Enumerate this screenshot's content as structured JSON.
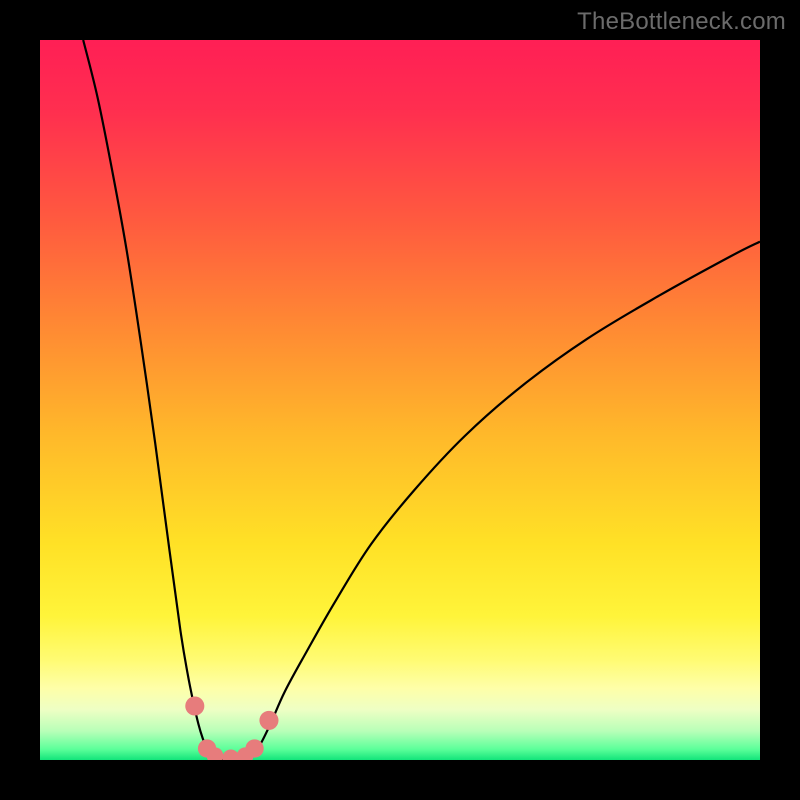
{
  "watermark": {
    "text": "TheBottleneck.com"
  },
  "colors": {
    "black": "#000000",
    "curve": "#000000",
    "marker": "#e77c7c",
    "gradient_stops": [
      {
        "offset": 0.0,
        "color": "#ff1f55"
      },
      {
        "offset": 0.1,
        "color": "#ff2f4f"
      },
      {
        "offset": 0.25,
        "color": "#ff5a3f"
      },
      {
        "offset": 0.4,
        "color": "#ff8a33"
      },
      {
        "offset": 0.55,
        "color": "#ffb92a"
      },
      {
        "offset": 0.7,
        "color": "#ffe126"
      },
      {
        "offset": 0.8,
        "color": "#fff43a"
      },
      {
        "offset": 0.86,
        "color": "#fffb72"
      },
      {
        "offset": 0.9,
        "color": "#feffa8"
      },
      {
        "offset": 0.93,
        "color": "#eeffc4"
      },
      {
        "offset": 0.96,
        "color": "#b8ffb8"
      },
      {
        "offset": 0.985,
        "color": "#5cff9a"
      },
      {
        "offset": 1.0,
        "color": "#12e47a"
      }
    ]
  },
  "chart_data": {
    "type": "line",
    "title": "",
    "xlabel": "",
    "ylabel": "",
    "xlim": [
      0,
      100
    ],
    "ylim": [
      0,
      100
    ],
    "grid": false,
    "series": [
      {
        "name": "left-curve",
        "x": [
          6,
          8,
          10,
          12,
          14,
          16,
          18,
          19.5,
          20.5,
          21.3,
          22,
          22.6,
          23.2,
          23.8
        ],
        "y": [
          100,
          92,
          82,
          71,
          58,
          44,
          29,
          18,
          12,
          8,
          5,
          3,
          1.5,
          0.4
        ]
      },
      {
        "name": "valley-floor",
        "x": [
          23.8,
          25.0,
          26.5,
          28.0,
          29.2
        ],
        "y": [
          0.4,
          0.1,
          0.05,
          0.1,
          0.4
        ]
      },
      {
        "name": "right-curve",
        "x": [
          29.2,
          30.5,
          32,
          34,
          37,
          41,
          46,
          52,
          59,
          67,
          76,
          86,
          96,
          100
        ],
        "y": [
          0.4,
          2,
          5,
          9.5,
          15,
          22,
          30,
          37.5,
          45,
          52,
          58.5,
          64.5,
          70,
          72
        ]
      }
    ],
    "markers": {
      "name": "valley-markers",
      "points": [
        {
          "x": 21.5,
          "y": 7.5,
          "r": 1.4
        },
        {
          "x": 23.2,
          "y": 1.6,
          "r": 1.3
        },
        {
          "x": 24.3,
          "y": 0.6,
          "r": 1.1
        },
        {
          "x": 26.5,
          "y": 0.3,
          "r": 1.1
        },
        {
          "x": 28.5,
          "y": 0.6,
          "r": 1.1
        },
        {
          "x": 29.8,
          "y": 1.6,
          "r": 1.3
        },
        {
          "x": 31.8,
          "y": 5.5,
          "r": 1.4
        }
      ]
    }
  }
}
